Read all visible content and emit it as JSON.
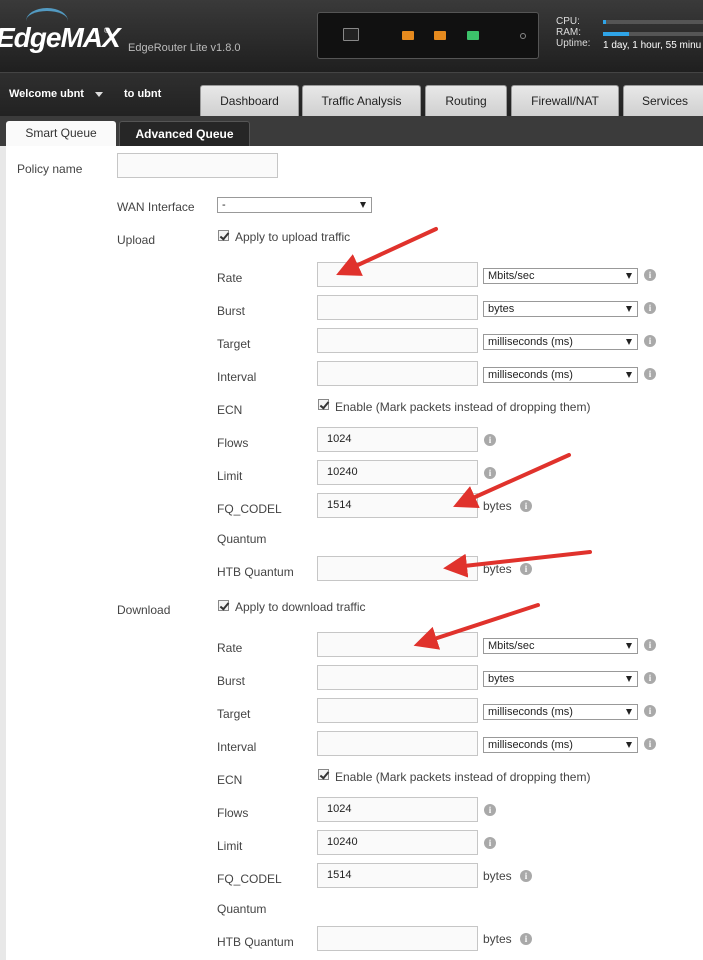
{
  "header": {
    "logo": "EdgeMAX",
    "reg_mark": "®",
    "model": "EdgeRouter Lite v1.8.0",
    "cpu_label": "CPU:",
    "ram_label": "RAM:",
    "uptime_label": "Uptime:",
    "uptime_value": "1 day, 1 hour, 55 minu",
    "cpu_fraction": 0.03,
    "ram_fraction": 0.26
  },
  "nav": {
    "welcome": "Welcome ubnt",
    "to_user": "to ubnt",
    "tabs": [
      "Dashboard",
      "Traffic Analysis",
      "Routing",
      "Firewall/NAT",
      "Services"
    ]
  },
  "subtabs": [
    "Smart Queue",
    "Advanced Queue"
  ],
  "form": {
    "policy_name_label": "Policy name",
    "policy_name_value": "",
    "wan_interface_label": "WAN Interface",
    "wan_interface_value": "-",
    "upload": {
      "section_label": "Upload",
      "apply_label": "Apply to upload traffic",
      "rate_label": "Rate",
      "rate_value": "",
      "rate_unit": "Mbits/sec",
      "burst_label": "Burst",
      "burst_value": "",
      "burst_unit": "bytes",
      "target_label": "Target",
      "target_value": "",
      "target_unit": "milliseconds (ms)",
      "interval_label": "Interval",
      "interval_value": "",
      "interval_unit": "milliseconds (ms)",
      "ecn_label": "ECN",
      "ecn_text": "Enable (Mark packets instead of dropping them)",
      "flows_label": "Flows",
      "flows_value": "1024",
      "limit_label": "Limit",
      "limit_value": "10240",
      "fq_label": "FQ_CODEL",
      "fq_label2": "Quantum",
      "fq_value": "1514",
      "fq_unit": "bytes",
      "htb_label": "HTB Quantum",
      "htb_value": "",
      "htb_unit": "bytes"
    },
    "download": {
      "section_label": "Download",
      "apply_label": "Apply to download traffic",
      "rate_label": "Rate",
      "rate_value": "",
      "rate_unit": "Mbits/sec",
      "burst_label": "Burst",
      "burst_value": "",
      "burst_unit": "bytes",
      "target_label": "Target",
      "target_value": "",
      "target_unit": "milliseconds (ms)",
      "interval_label": "Interval",
      "interval_value": "",
      "interval_unit": "milliseconds (ms)",
      "ecn_label": "ECN",
      "ecn_text": "Enable (Mark packets instead of dropping them)",
      "flows_label": "Flows",
      "flows_value": "1024",
      "limit_label": "Limit",
      "limit_value": "10240",
      "fq_label": "FQ_CODEL",
      "fq_label2": "Quantum",
      "fq_value": "1514",
      "fq_unit": "bytes",
      "htb_label": "HTB Quantum",
      "htb_value": "",
      "htb_unit": "bytes"
    }
  },
  "info_glyph": "i",
  "colors": {
    "accent": "#2fa4e7",
    "arrow": "#e0322c",
    "port_orange": "#e68a1e",
    "port_green": "#3cc26a"
  }
}
